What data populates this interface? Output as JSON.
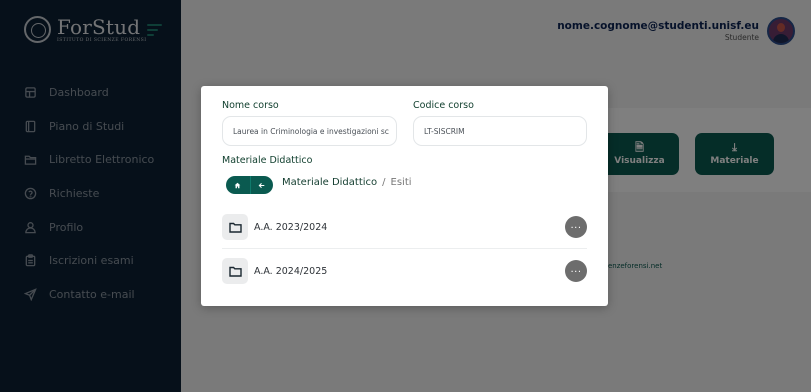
{
  "sidebar": {
    "logo_title": "ForStud",
    "logo_subtitle": "ISTITUTO DI SCIENZE FORENSI",
    "items": [
      {
        "label": "Dashboard",
        "icon": "dashboard-icon"
      },
      {
        "label": "Piano di Studi",
        "icon": "book-icon"
      },
      {
        "label": "Libretto Elettronico",
        "icon": "folder-icon"
      },
      {
        "label": "Richieste",
        "icon": "question-icon"
      },
      {
        "label": "Profilo",
        "icon": "user-icon"
      },
      {
        "label": "Iscrizioni esami",
        "icon": "clipboard-icon"
      },
      {
        "label": "Contatto e-mail",
        "icon": "send-icon"
      }
    ]
  },
  "header": {
    "user_email": "nome.cognome@studenti.unisf.eu",
    "user_role": "Studente"
  },
  "background": {
    "buttons": [
      {
        "label": "Visualizza",
        "icon": "document-icon"
      },
      {
        "label": "Materiale",
        "icon": "download-icon"
      }
    ],
    "link_text": "ienzeforensi.net"
  },
  "modal": {
    "course_name_label": "Nome corso",
    "course_name_value": "Laurea in Criminologia e investigazioni sc",
    "course_code_label": "Codice corso",
    "course_code_value": "LT-SISCRIM",
    "section_label": "Materiale Didattico",
    "breadcrumb": {
      "home_icon": "home-icon",
      "back_icon": "arrow-left-icon",
      "items": [
        "Materiale Didattico",
        "Esiti"
      ],
      "separator": "/"
    },
    "folders": [
      {
        "label": "A.A. 2023/2024",
        "more": "..."
      },
      {
        "label": "A.A. 2024/2025",
        "more": "..."
      }
    ]
  },
  "colors": {
    "sidebar_bg": "#0d2134",
    "accent": "#0a5a50",
    "email_text": "#0d2455"
  }
}
